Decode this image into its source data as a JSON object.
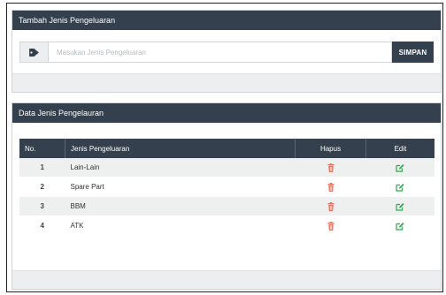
{
  "add_panel": {
    "title": "Tambah Jenis Pengeluaran",
    "input_placeholder": "Masukan Jenis Pengeluaran",
    "input_icon": "tag-icon",
    "save_label": "SIMPAN"
  },
  "list_panel": {
    "title": "Data Jenis Pengelauran",
    "columns": [
      "No.",
      "Jenis Pengeluaran",
      "Hapus",
      "Edit"
    ],
    "rows": [
      {
        "no": "1",
        "name": "Lain-Lain"
      },
      {
        "no": "2",
        "name": "Spare Part"
      },
      {
        "no": "3",
        "name": "BBM"
      },
      {
        "no": "4",
        "name": "ATK"
      }
    ],
    "delete_icon": "trash-icon",
    "edit_icon": "edit-icon"
  },
  "colors": {
    "header": "#34404d",
    "delete": "#e8715f",
    "edit": "#2fa84f"
  }
}
